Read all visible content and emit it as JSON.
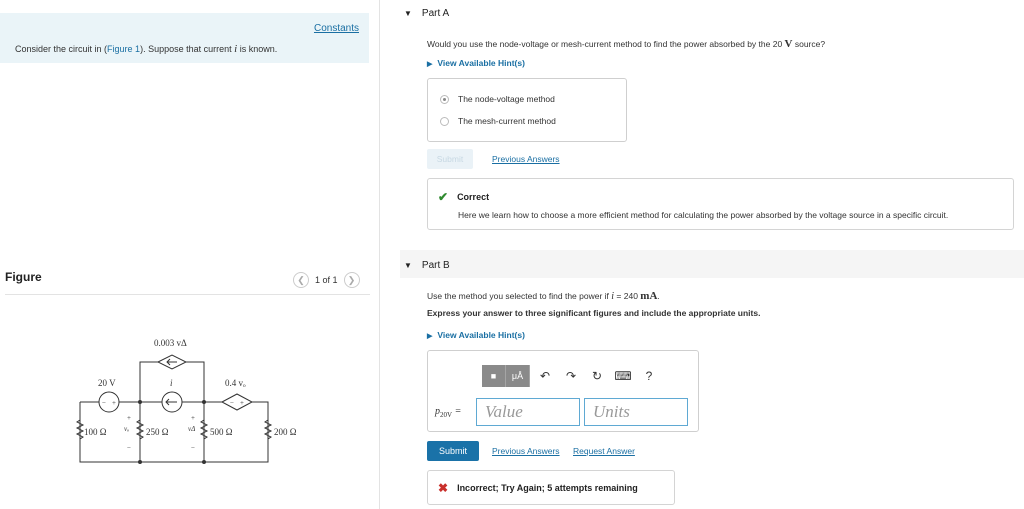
{
  "intro": {
    "constants_link": "Constants",
    "text_before": "Consider the circuit in (",
    "figure_link": "Figure 1",
    "text_middle": "). Suppose that current ",
    "var_i": "i",
    "text_after": " is known."
  },
  "figure": {
    "label": "Figure",
    "pager": "1 of 1",
    "prev_glyph": "❮",
    "next_glyph": "❯",
    "circuit_labels": {
      "dep_top": "0.003 vΔ",
      "source_20v": "20 V",
      "current_i": "i",
      "dep_right": "0.4 vₒ",
      "r100": "100 Ω",
      "r250": "250 Ω",
      "r500": "500 Ω",
      "r200": "200 Ω",
      "vo": "vₒ",
      "vdelta": "vΔ",
      "plus": "+",
      "minus": "−"
    }
  },
  "part_a": {
    "title": "Part A",
    "question_before": "Would you use the node-voltage or mesh-current method to find the power absorbed by the 20 ",
    "question_unit": "V",
    "question_after": " source?",
    "hint": "View Available Hint(s)",
    "choices": [
      {
        "label": "The node-voltage method",
        "selected": true
      },
      {
        "label": "The mesh-current method",
        "selected": false
      }
    ],
    "submit": "Submit",
    "previous_answers": "Previous Answers",
    "feedback_title": "Correct",
    "feedback_msg": "Here we learn how to choose a more efficient method for calculating the power absorbed by the voltage source in a specific circuit."
  },
  "part_b": {
    "title": "Part B",
    "question_before": "Use the method you selected to find the power if ",
    "question_var": "i",
    "question_after": " = 240 ",
    "question_unit": "mA",
    "question_end": ".",
    "instruction": "Express your answer to three significant figures and include the appropriate units.",
    "hint": "View Available Hint(s)",
    "toolbar": {
      "templates": "■",
      "units": "μÅ",
      "undo": "↶",
      "redo": "↷",
      "reset": "↻",
      "keyboard": "⌨",
      "help": "?"
    },
    "answer_label_main": "p",
    "answer_label_sub": "20V",
    "answer_eq": " =",
    "value_placeholder": "Value",
    "units_placeholder": "Units",
    "submit": "Submit",
    "previous_answers": "Previous Answers",
    "request_answer": "Request Answer",
    "feedback": "Incorrect; Try Again; 5 attempts remaining"
  },
  "colors": {
    "link": "#1a6fa3",
    "submit": "#1a72a8",
    "correct": "#2f8a2f",
    "incorrect": "#c9302c",
    "intro_bg": "#eaf4f8"
  }
}
